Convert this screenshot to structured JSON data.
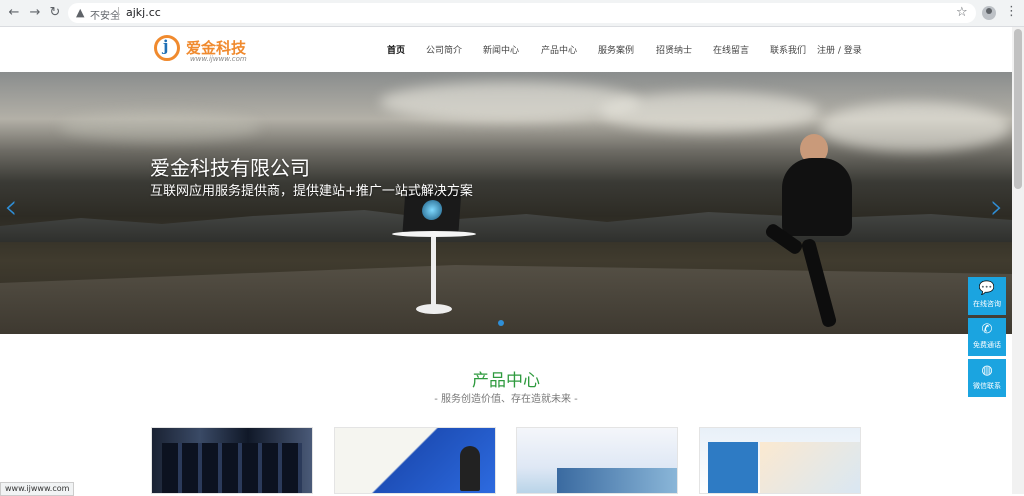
{
  "browser": {
    "security_label": "不安全",
    "url": "ajkj.cc",
    "status_url": "www.ijwww.com"
  },
  "site": {
    "logo_letter": "j",
    "logo_name": "爱金科技",
    "logo_url": "www.ijwww.com"
  },
  "nav": [
    {
      "label": "首页"
    },
    {
      "label": "公司简介"
    },
    {
      "label": "新闻中心"
    },
    {
      "label": "产品中心"
    },
    {
      "label": "服务案例"
    },
    {
      "label": "招贤纳士"
    },
    {
      "label": "在线留言"
    },
    {
      "label": "联系我们"
    },
    {
      "label": "注册 / 登录"
    }
  ],
  "banner": {
    "title": "爱金科技有限公司",
    "subtitle": "互联网应用服务提供商，提供建站+推广一站式解决方案"
  },
  "float_bar": [
    {
      "label": "在线咨询",
      "icon": "chat-icon"
    },
    {
      "label": "免费通话",
      "icon": "phone-icon"
    },
    {
      "label": "微信联系",
      "icon": "wechat-icon"
    }
  ],
  "products": {
    "title": "产品中心",
    "subtitle": "- 服务创造价值、存在造就未来 -"
  },
  "colors": {
    "accent": "#1ba4e0",
    "brand_orange": "#f08a2e",
    "section_green": "#2e9a3e"
  }
}
